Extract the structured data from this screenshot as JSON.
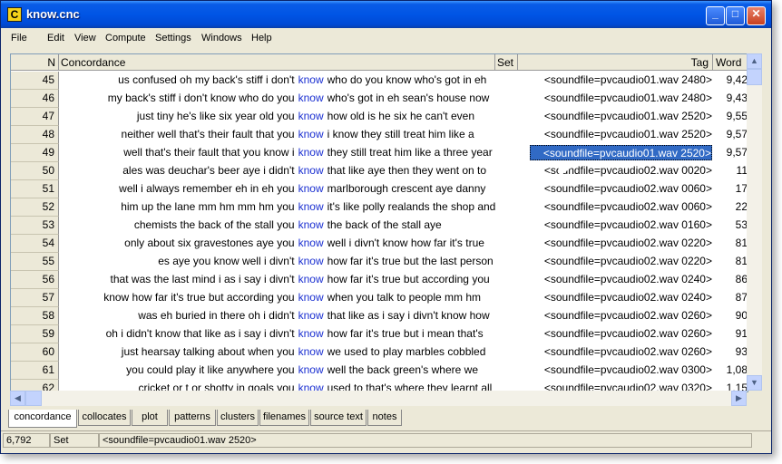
{
  "window": {
    "title": "know.cnc",
    "app_icon": "C"
  },
  "menu": [
    "File",
    "Edit",
    "View",
    "Compute",
    "Settings",
    "Windows",
    "Help"
  ],
  "columns": {
    "n": "N",
    "concordance": "Concordance",
    "set": "Set",
    "tag": "Tag",
    "word": "Word"
  },
  "rows": [
    {
      "n": "45",
      "left": "us confused oh my back's stiff i don't",
      "kw": "know",
      "right": "who do you know who's got in eh",
      "tag": "<soundfile=pvcaudio01.wav 2480>",
      "word": "9,42"
    },
    {
      "n": "46",
      "left": "my back's stiff i don't know who do you",
      "kw": "know",
      "right": "who's got in eh sean's house now",
      "tag": "<soundfile=pvcaudio01.wav 2480>",
      "word": "9,43"
    },
    {
      "n": "47",
      "left": "just tiny he's like six year old you",
      "kw": "know",
      "right": "how old is he six he can't even",
      "tag": "<soundfile=pvcaudio01.wav 2520>",
      "word": "9,55"
    },
    {
      "n": "48",
      "left": "neither well that's their fault that you",
      "kw": "know",
      "right": "i know they still treat him like a",
      "tag": "<soundfile=pvcaudio01.wav 2520>",
      "word": "9,57"
    },
    {
      "n": "49",
      "left": "well that's their fault that you know i",
      "kw": "know",
      "right": "they still treat him like a three year",
      "tag": "<soundfile=pvcaudio01.wav 2520>",
      "word": "9,57"
    },
    {
      "n": "50",
      "left": "ales was deuchar's beer aye i didn't",
      "kw": "know",
      "right": "that like aye then they went on to",
      "tag": "<soundfile=pvcaudio02.wav 0020>",
      "word": "11"
    },
    {
      "n": "51",
      "left": "well i always remember eh in eh you",
      "kw": "know",
      "right": "marlborough crescent aye danny",
      "tag": "<soundfile=pvcaudio02.wav 0060>",
      "word": "17"
    },
    {
      "n": "52",
      "left": "him up the lane mm hm mm hm you",
      "kw": "know",
      "right": "it's like polly realands the shop and",
      "tag": "<soundfile=pvcaudio02.wav 0060>",
      "word": "22"
    },
    {
      "n": "53",
      "left": "chemists the back of the stall you",
      "kw": "know",
      "right": "the back of the stall aye",
      "tag": "<soundfile=pvcaudio02.wav 0160>",
      "word": "53"
    },
    {
      "n": "54",
      "left": "only about six gravestones aye you",
      "kw": "know",
      "right": "well i divn't know how far it's true",
      "tag": "<soundfile=pvcaudio02.wav 0220>",
      "word": "81"
    },
    {
      "n": "55",
      "left": "es aye you know well i divn't",
      "kw": "know",
      "right": "how far it's true but the last person",
      "tag": "<soundfile=pvcaudio02.wav 0220>",
      "word": "81"
    },
    {
      "n": "56",
      "left": "that was the last mind i as i say i divn't",
      "kw": "know",
      "right": "how far it's true but according you",
      "tag": "<soundfile=pvcaudio02.wav 0240>",
      "word": "86"
    },
    {
      "n": "57",
      "left": "know how far it's true but according you",
      "kw": "know",
      "right": "when you talk to people mm hm",
      "tag": "<soundfile=pvcaudio02.wav 0240>",
      "word": "87"
    },
    {
      "n": "58",
      "left": "was eh buried in there oh i didn't",
      "kw": "know",
      "right": "that like as i say i divn't know how",
      "tag": "<soundfile=pvcaudio02.wav 0260>",
      "word": "90"
    },
    {
      "n": "59",
      "left": "oh i didn't know that like as i say i divn't",
      "kw": "know",
      "right": "how far it's true but i mean that's",
      "tag": "<soundfile=pvcaudio02.wav 0260>",
      "word": "91"
    },
    {
      "n": "60",
      "left": "just hearsay talking about when you",
      "kw": "know",
      "right": "we used to play marbles cobbled",
      "tag": "<soundfile=pvcaudio02.wav 0260>",
      "word": "93"
    },
    {
      "n": "61",
      "left": "you could play it like anywhere you",
      "kw": "know",
      "right": "well the back green's where we",
      "tag": "<soundfile=pvcaudio02.wav 0300>",
      "word": "1,08"
    },
    {
      "n": "62",
      "left": "cricket or t or shotty in goals you",
      "kw": "know",
      "right": "used to that's where they learnt all",
      "tag": "<soundfile=pvcaudio02.wav 0320>",
      "word": "1,15"
    }
  ],
  "tabs": [
    "concordance",
    "collocates",
    "plot",
    "patterns",
    "clusters",
    "filenames",
    "source text",
    "notes"
  ],
  "status": {
    "count": "6,792",
    "mode": "Set",
    "current": "<soundfile=pvcaudio01.wav 2520>"
  },
  "colors": {
    "keyword": "#1a2fd1",
    "selection": "#316ac5"
  },
  "icons": [
    "minimize-icon",
    "maximize-icon",
    "close-icon",
    "scroll-up-icon",
    "scroll-down-icon",
    "scroll-left-icon",
    "scroll-right-icon",
    "mouse-cursor-icon"
  ]
}
